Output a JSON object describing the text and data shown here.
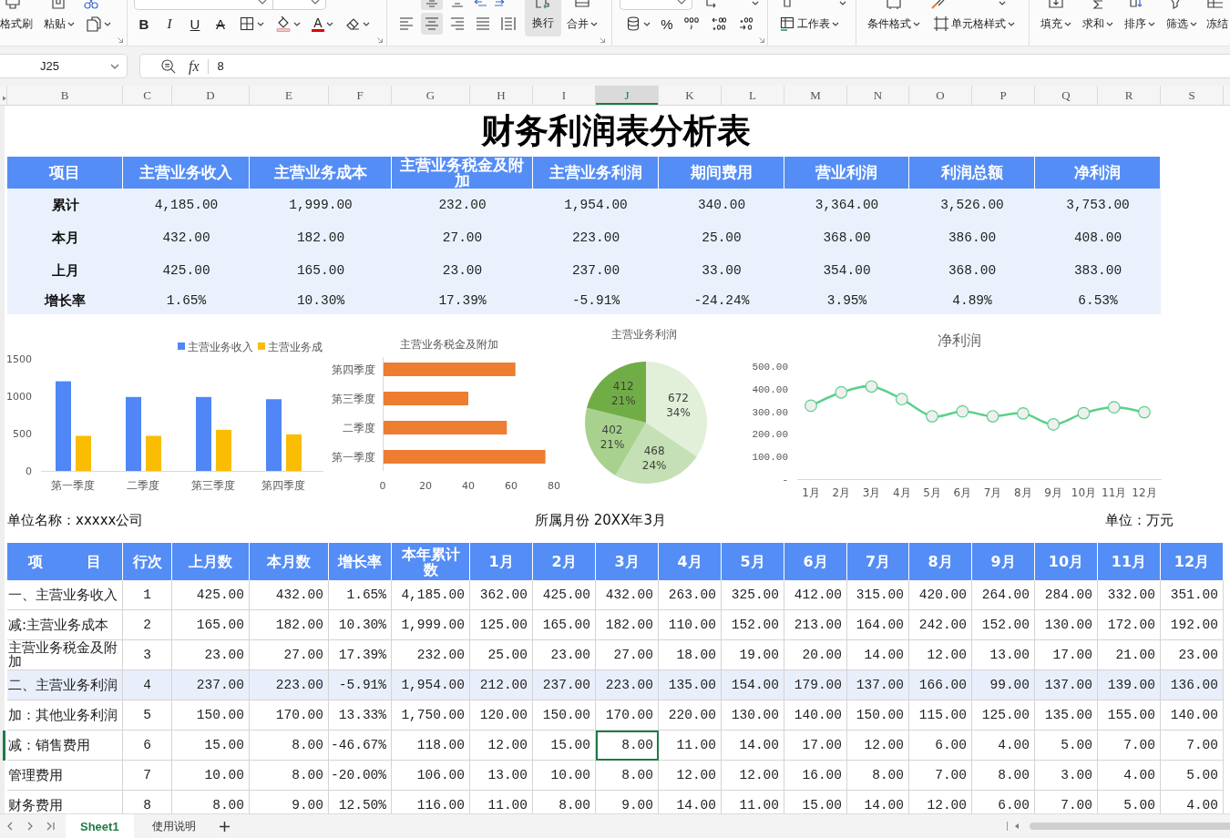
{
  "ribbon": {
    "format_painter": "格式刷",
    "paste": "粘贴",
    "font_styles": [
      {
        "kind": "bold",
        "label": "B"
      },
      {
        "kind": "italic",
        "label": "I"
      },
      {
        "kind": "underline",
        "label": "U"
      },
      {
        "kind": "strike",
        "label": "A"
      }
    ],
    "font_color": "A",
    "vertical_alignment": [
      {
        "kind": "middle",
        "selected": true
      },
      {
        "kind": "bottom",
        "selected": false
      }
    ],
    "alignment": [
      {
        "kind": "left",
        "selected": false
      },
      {
        "kind": "center",
        "selected": true
      },
      {
        "kind": "right",
        "selected": false
      },
      {
        "kind": "justify",
        "selected": false
      },
      {
        "kind": "distributed",
        "selected": false
      }
    ],
    "wrap_text": {
      "label": "换行",
      "selected": true
    },
    "merge": "合并",
    "percent": "%",
    "worksheet": "工作表",
    "conditional_format": "条件格式",
    "cell_style": "单元格样式",
    "editing": [
      {
        "label": "填充",
        "dropdown": true
      },
      {
        "label": "求和",
        "dropdown": true
      },
      {
        "label": "排序",
        "dropdown": true
      },
      {
        "label": "筛选",
        "dropdown": true
      },
      {
        "label": "冻结",
        "dropdown": false
      }
    ]
  },
  "formula_bar": {
    "cell_ref": "J25",
    "function_label": "fx",
    "content": "8"
  },
  "column_headers": [
    {
      "label": "B",
      "selected": false
    },
    {
      "label": "C",
      "selected": false
    },
    {
      "label": "D",
      "selected": false
    },
    {
      "label": "E",
      "selected": false
    },
    {
      "label": "F",
      "selected": false
    },
    {
      "label": "G",
      "selected": false
    },
    {
      "label": "H",
      "selected": false
    },
    {
      "label": "I",
      "selected": false
    },
    {
      "label": "J",
      "selected": true
    },
    {
      "label": "K",
      "selected": false
    },
    {
      "label": "L",
      "selected": false
    },
    {
      "label": "M",
      "selected": false
    },
    {
      "label": "N",
      "selected": false
    },
    {
      "label": "O",
      "selected": false
    },
    {
      "label": "P",
      "selected": false
    },
    {
      "label": "Q",
      "selected": false
    },
    {
      "label": "R",
      "selected": false
    },
    {
      "label": "S",
      "selected": false
    }
  ],
  "title": "财务利润表分析表",
  "summary_table": {
    "columns": [
      "项目",
      "主营业务收入",
      "主营业务成本",
      "主营业务税金及附加",
      "主营业务利润",
      "期间费用",
      "营业利润",
      "利润总额",
      "净利润"
    ],
    "rows": [
      {
        "label": "累计",
        "values": [
          "4,185.00",
          "1,999.00",
          "232.00",
          "1,954.00",
          "340.00",
          "3,364.00",
          "3,526.00",
          "3,753.00"
        ]
      },
      {
        "label": "本月",
        "values": [
          "432.00",
          "182.00",
          "27.00",
          "223.00",
          "25.00",
          "368.00",
          "386.00",
          "408.00"
        ]
      },
      {
        "label": "上月",
        "values": [
          "425.00",
          "165.00",
          "23.00",
          "237.00",
          "33.00",
          "354.00",
          "368.00",
          "383.00"
        ]
      },
      {
        "label": "增长率",
        "values": [
          "1.65%",
          "10.30%",
          "17.39%",
          "-5.91%",
          "-24.24%",
          "3.95%",
          "4.89%",
          "6.53%"
        ]
      }
    ]
  },
  "charts": [
    {
      "chart_data": {
        "type": "bar",
        "legend": true,
        "categories": [
          "第一季度",
          "二季度",
          "第三季度",
          "第四季度"
        ],
        "series": [
          {
            "name": "主营业务收入",
            "color": "#5086f6",
            "values": [
              1200,
              990,
              990,
              960
            ]
          },
          {
            "name": "主营业务成",
            "color": "#fbbc04",
            "values": [
              470,
              470,
              550,
              490
            ]
          }
        ],
        "ylim": [
          0,
          1500
        ],
        "yticks": [
          0,
          500,
          1000,
          1500
        ]
      }
    },
    {
      "chart_data": {
        "type": "bar",
        "orientation": "horizontal",
        "title": "主营业务税金及附加",
        "categories": [
          "第四季度",
          "第三季度",
          "二季度",
          "第一季度"
        ],
        "series": [
          {
            "color": "#ed7d31",
            "values": [
              62,
              40,
              58,
              76
            ]
          }
        ],
        "xlim": [
          0,
          80
        ],
        "xticks": [
          0,
          20,
          40,
          60,
          80
        ]
      }
    },
    {
      "chart_data": {
        "type": "pie",
        "title": "主营业务利润",
        "values": [
          672,
          468,
          402,
          412
        ],
        "colors": [
          "#e2f0d9",
          "#c5e0b4",
          "#a9d18e",
          "#70ad47"
        ],
        "value_labels": [
          "672 34%",
          "468 24%",
          "402 21%",
          "412 21%"
        ]
      }
    },
    {
      "chart_data": {
        "type": "line",
        "title": "净利润",
        "categories": [
          "1月",
          "2月",
          "3月",
          "4月",
          "5月",
          "6月",
          "7月",
          "8月",
          "9月",
          "10月",
          "11月",
          "12月"
        ],
        "series": [
          {
            "color": "#5bd08a",
            "marker": "circle",
            "values": [
              325,
              384,
              410,
              354,
              278,
              300,
              278,
              291,
              242,
              292,
              318,
              296
            ]
          }
        ],
        "ylim": [
          0,
          500
        ],
        "yticks": [
          {
            "value": 0,
            "label": "-"
          },
          {
            "value": 100,
            "label": "100.00"
          },
          {
            "value": 200,
            "label": "200.00"
          },
          {
            "value": 300,
            "label": "300.00"
          },
          {
            "value": 400,
            "label": "400.00"
          },
          {
            "value": 500,
            "label": "500.00"
          }
        ]
      }
    }
  ],
  "report_info": {
    "company": "单位名称：xxxxx公司",
    "period": "所属月份 20XX年3月",
    "unit": "单位：万元"
  },
  "detail_table": {
    "columns": [
      "项　　　目",
      "行次",
      "上月数",
      "本月数",
      "增长率",
      "本年累计数",
      "1月",
      "2月",
      "3月",
      "4月",
      "5月",
      "6月",
      "7月",
      "8月",
      "9月",
      "10月",
      "11月",
      "12月"
    ],
    "rows": [
      {
        "highlighted": false,
        "selected": false,
        "cells": [
          "一、主营业务收入",
          "1",
          "425.00",
          "432.00",
          "1.65%",
          "4,185.00",
          "362.00",
          "425.00",
          "432.00",
          "263.00",
          "325.00",
          "412.00",
          "315.00",
          "420.00",
          "264.00",
          "284.00",
          "332.00",
          "351.00"
        ]
      },
      {
        "highlighted": false,
        "selected": false,
        "cells": [
          "减:主营业务成本",
          "2",
          "165.00",
          "182.00",
          "10.30%",
          "1,999.00",
          "125.00",
          "165.00",
          "182.00",
          "110.00",
          "152.00",
          "213.00",
          "164.00",
          "242.00",
          "152.00",
          "130.00",
          "172.00",
          "192.00"
        ]
      },
      {
        "highlighted": false,
        "selected": false,
        "cells": [
          "主营业务税金及附加",
          "3",
          "23.00",
          "27.00",
          "17.39%",
          "232.00",
          "25.00",
          "23.00",
          "27.00",
          "18.00",
          "19.00",
          "20.00",
          "14.00",
          "12.00",
          "13.00",
          "17.00",
          "21.00",
          "23.00"
        ]
      },
      {
        "highlighted": true,
        "selected": false,
        "cells": [
          "二、主营业务利润",
          "4",
          "237.00",
          "223.00",
          "-5.91%",
          "1,954.00",
          "212.00",
          "237.00",
          "223.00",
          "135.00",
          "154.00",
          "179.00",
          "137.00",
          "166.00",
          "99.00",
          "137.00",
          "139.00",
          "136.00"
        ]
      },
      {
        "highlighted": false,
        "selected": false,
        "cells": [
          "加：其他业务利润",
          "5",
          "150.00",
          "170.00",
          "13.33%",
          "1,750.00",
          "120.00",
          "150.00",
          "170.00",
          "220.00",
          "130.00",
          "140.00",
          "150.00",
          "115.00",
          "125.00",
          "135.00",
          "155.00",
          "140.00"
        ]
      },
      {
        "highlighted": false,
        "selected": true,
        "cells": [
          "减：销售费用",
          "6",
          "15.00",
          "8.00",
          "-46.67%",
          "118.00",
          "12.00",
          "15.00",
          "8.00",
          "11.00",
          "14.00",
          "17.00",
          "12.00",
          "6.00",
          "4.00",
          "5.00",
          "7.00",
          "7.00"
        ]
      },
      {
        "highlighted": false,
        "selected": false,
        "cells": [
          "管理费用",
          "7",
          "10.00",
          "8.00",
          "-20.00%",
          "106.00",
          "13.00",
          "10.00",
          "8.00",
          "12.00",
          "12.00",
          "16.00",
          "8.00",
          "7.00",
          "8.00",
          "3.00",
          "4.00",
          "5.00"
        ]
      },
      {
        "highlighted": false,
        "selected": false,
        "cells": [
          "财务费用",
          "8",
          "8.00",
          "9.00",
          "12.50%",
          "116.00",
          "11.00",
          "8.00",
          "9.00",
          "14.00",
          "11.00",
          "15.00",
          "14.00",
          "12.00",
          "6.00",
          "7.00",
          "5.00",
          "4.00"
        ]
      }
    ]
  },
  "sheet_tabs": [
    {
      "label": "Sheet1",
      "selected": true
    },
    {
      "label": "使用说明",
      "selected": false
    }
  ]
}
